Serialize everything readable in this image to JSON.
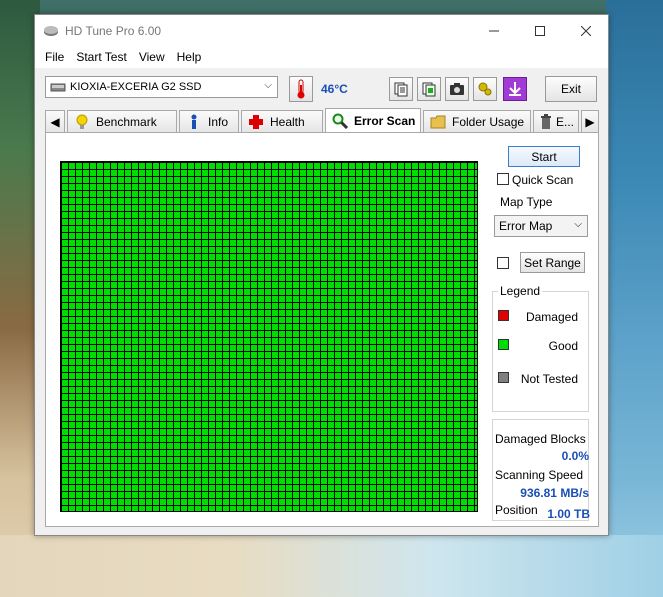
{
  "window": {
    "title": "HD Tune Pro 6.00"
  },
  "menu": [
    "File",
    "Start Test",
    "View",
    "Help"
  ],
  "toolbar": {
    "drive": "KIOXIA-EXCERIA G2 SSD",
    "temperature": "46°C",
    "exit_label": "Exit"
  },
  "tabs": [
    {
      "label": "Benchmark",
      "icon": "lightbulb-icon"
    },
    {
      "label": "Info",
      "icon": "info-icon"
    },
    {
      "label": "Health",
      "icon": "health-cross-icon"
    },
    {
      "label": "Error Scan",
      "icon": "magnifier-icon",
      "active": true
    },
    {
      "label": "Folder Usage",
      "icon": "folder-icon"
    },
    {
      "label": "E...",
      "icon": "trash-icon"
    }
  ],
  "error_scan": {
    "start_label": "Start",
    "quick_scan_label": "Quick Scan",
    "map_type_title": "Map Type",
    "map_type_value": "Error Map",
    "set_range_label": "Set Range",
    "legend_title": "Legend",
    "legend": [
      {
        "label": "Damaged",
        "color": "#e00000"
      },
      {
        "label": "Good",
        "color": "#00dd00"
      },
      {
        "label": "Not Tested",
        "color": "#808080"
      }
    ],
    "damaged_blocks_label": "Damaged Blocks",
    "damaged_blocks_value": "0.0%",
    "scanning_speed_label": "Scanning Speed",
    "scanning_speed_value": "936.81 MB/s",
    "position_label": "Position",
    "position_value": "1.00 TB",
    "block_state": "Good"
  }
}
